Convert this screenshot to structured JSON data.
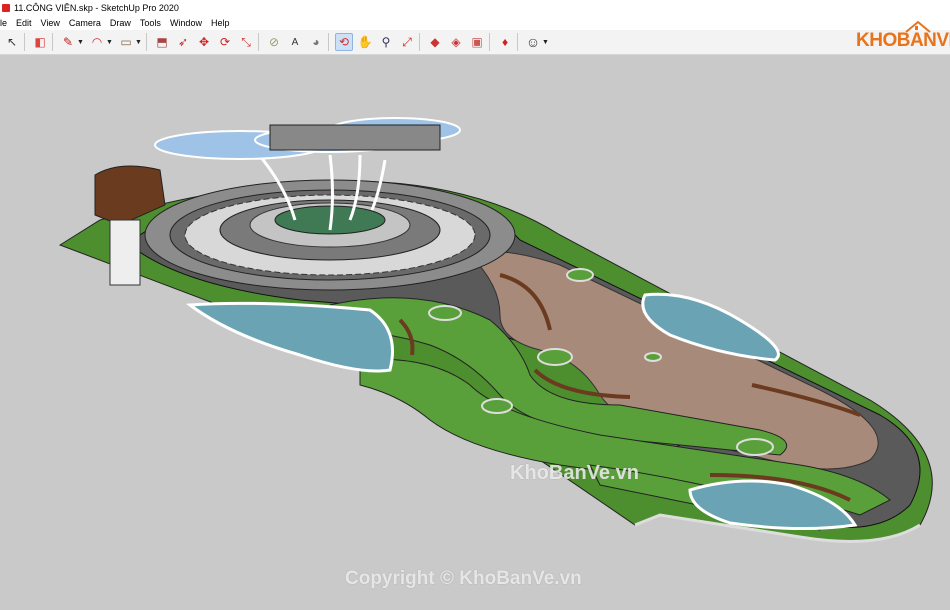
{
  "window": {
    "title": "11.CÔNG VIÊN.skp - SketchUp Pro 2020"
  },
  "menu": [
    "ile",
    "Edit",
    "View",
    "Camera",
    "Draw",
    "Tools",
    "Window",
    "Help"
  ],
  "toolbar": {
    "tools": [
      {
        "name": "select-icon",
        "glyph": "↖"
      },
      {
        "name": "eraser-icon",
        "glyph": "◧"
      },
      {
        "name": "pencil-icon",
        "glyph": "✎"
      },
      {
        "name": "arc-icon",
        "glyph": "◠"
      },
      {
        "name": "rectangle-icon",
        "glyph": "▭"
      },
      {
        "name": "push-pull-icon",
        "glyph": "⬒"
      },
      {
        "name": "follow-me-icon",
        "glyph": "➶"
      },
      {
        "name": "move-icon",
        "glyph": "✥"
      },
      {
        "name": "rotate-icon",
        "glyph": "⟳"
      },
      {
        "name": "scale-icon",
        "glyph": "⤡"
      },
      {
        "name": "tape-measure-icon",
        "glyph": "⊘"
      },
      {
        "name": "text-icon",
        "glyph": "A"
      },
      {
        "name": "paint-bucket-icon",
        "glyph": "◕"
      },
      {
        "name": "orbit-icon",
        "glyph": "⟲"
      },
      {
        "name": "pan-icon",
        "glyph": "✋"
      },
      {
        "name": "zoom-icon",
        "glyph": "⚲"
      },
      {
        "name": "zoom-extents-icon",
        "glyph": "⤢"
      },
      {
        "name": "warehouse-icon",
        "glyph": "◆"
      },
      {
        "name": "extension-warehouse-icon",
        "glyph": "◈"
      },
      {
        "name": "send-to-layout-icon",
        "glyph": "▣"
      },
      {
        "name": "ruby-icon",
        "glyph": "♦"
      },
      {
        "name": "account-icon",
        "glyph": "☺"
      }
    ]
  },
  "logo": {
    "text": "KHOBANVE"
  },
  "watermarks": {
    "center": "KhoBanVe.vn",
    "bottom": "Copyright © KhoBanVe.vn"
  }
}
